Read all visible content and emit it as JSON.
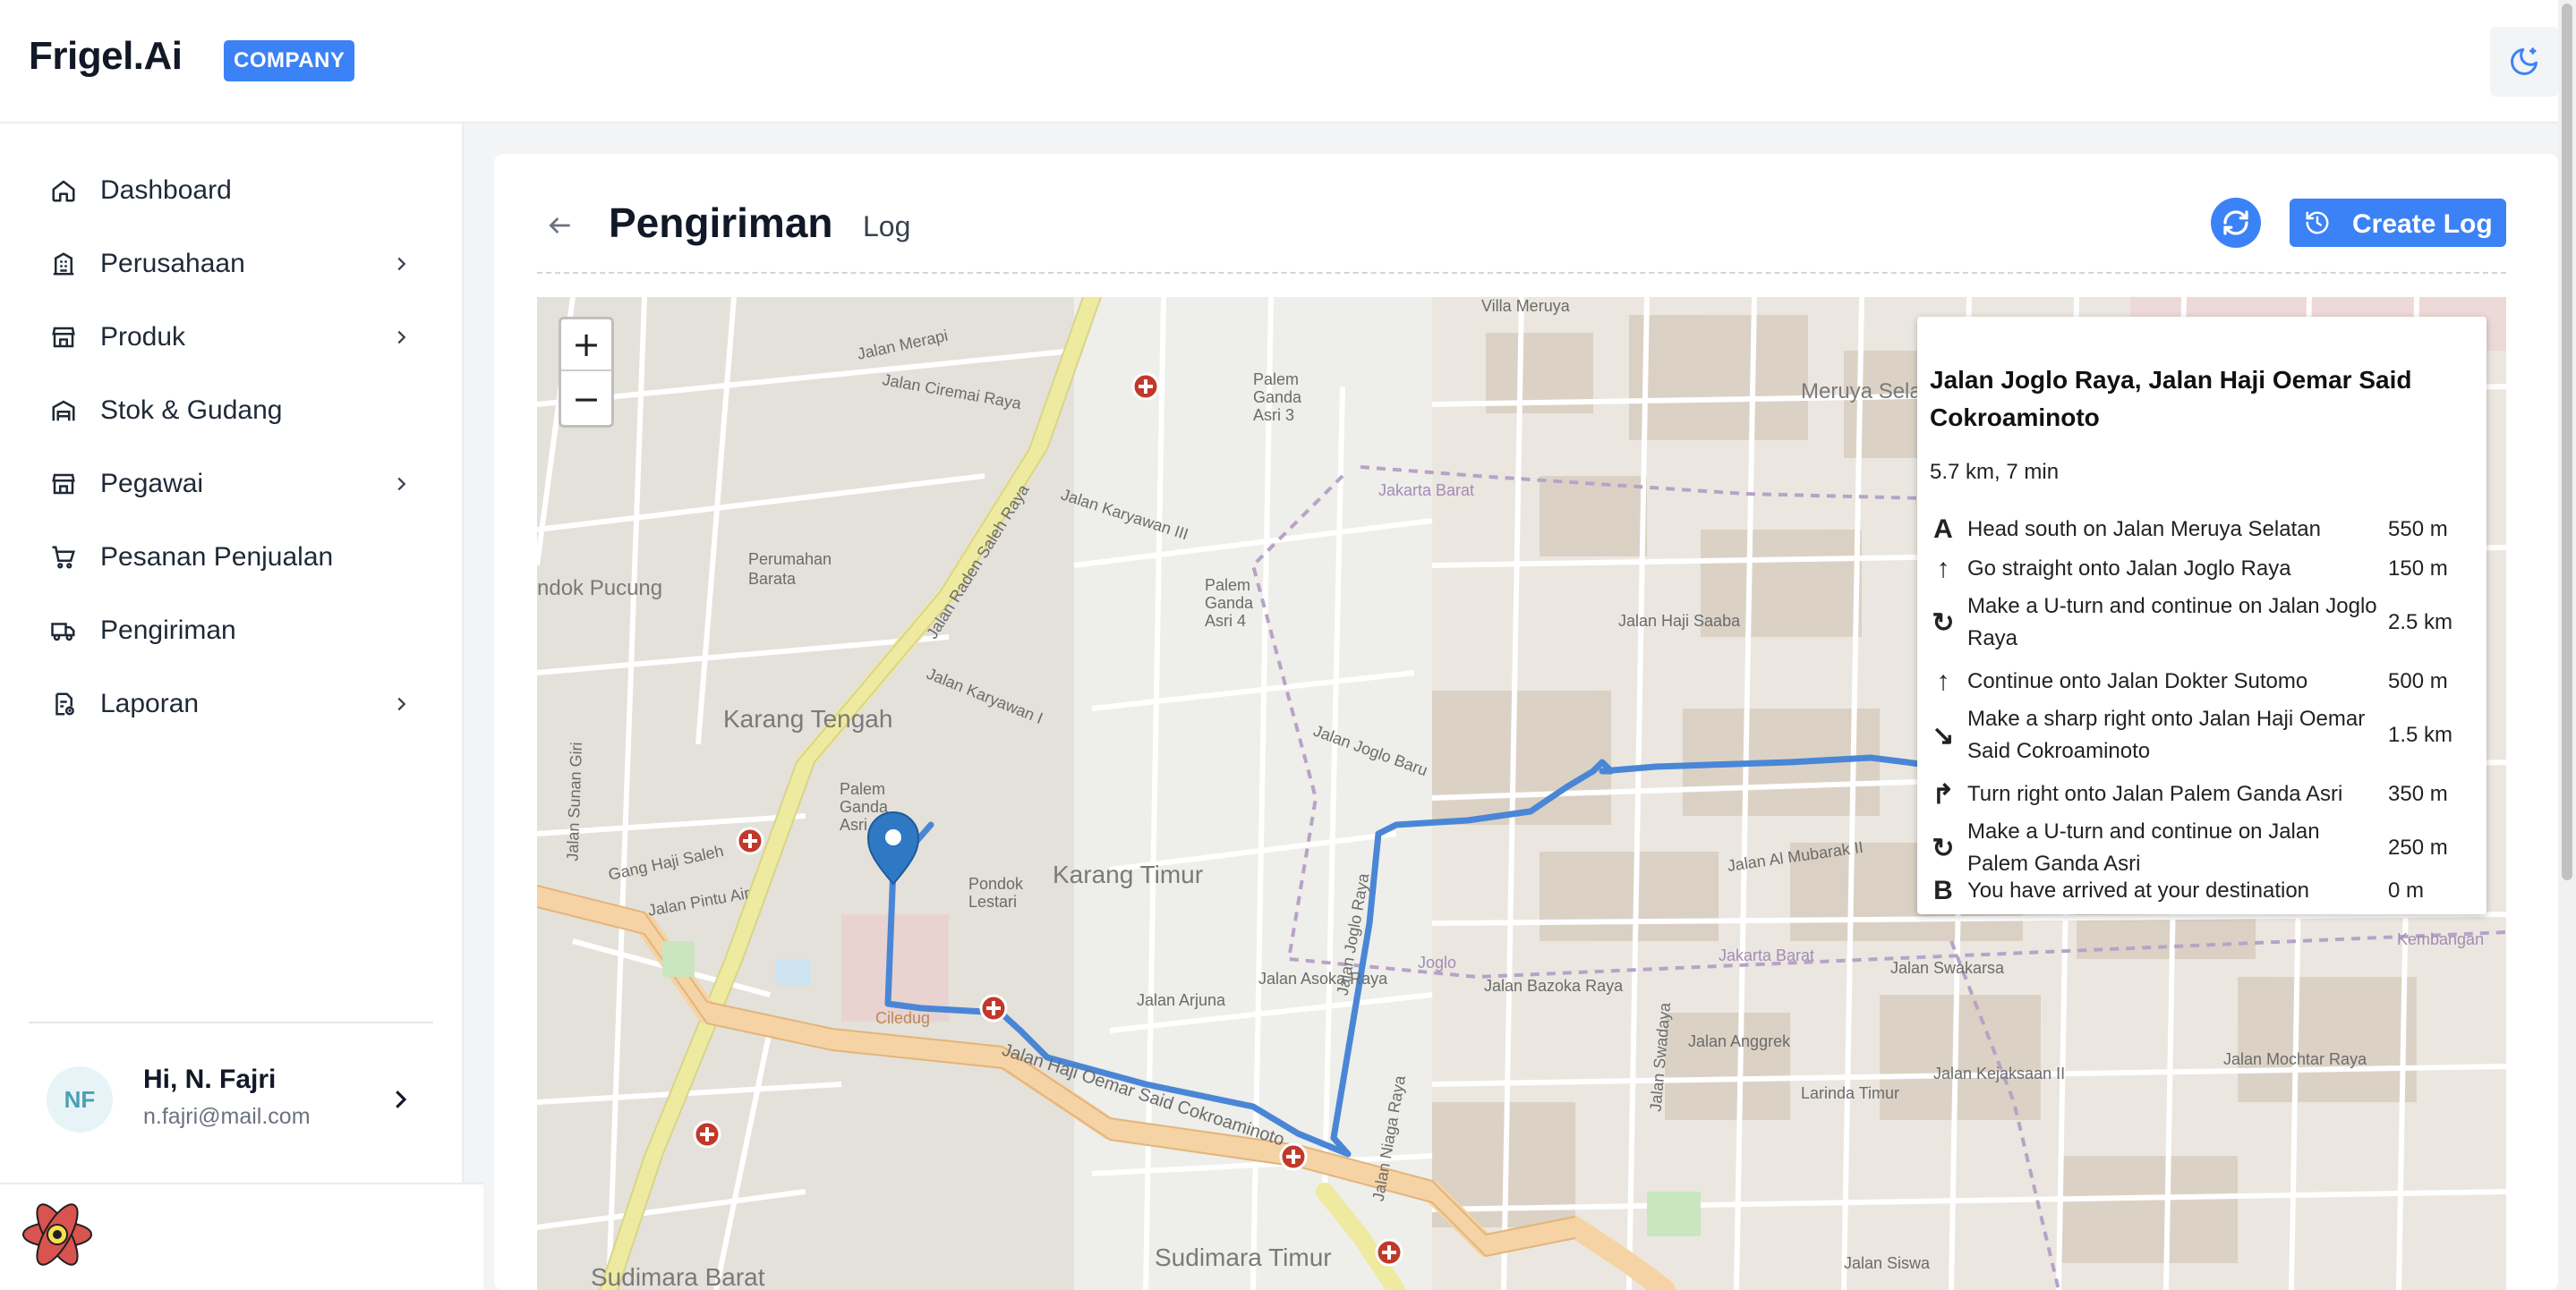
{
  "header": {
    "brand": "Frigel.Ai",
    "badge": "COMPANY",
    "theme_icon": "moon-icon"
  },
  "sidebar": {
    "items": [
      {
        "label": "Dashboard",
        "icon": "home-icon",
        "has_submenu": false
      },
      {
        "label": "Perusahaan",
        "icon": "building-icon",
        "has_submenu": true
      },
      {
        "label": "Produk",
        "icon": "store-icon",
        "has_submenu": true
      },
      {
        "label": "Stok & Gudang",
        "icon": "warehouse-icon",
        "has_submenu": false
      },
      {
        "label": "Pegawai",
        "icon": "store-icon",
        "has_submenu": true
      },
      {
        "label": "Pesanan Penjualan",
        "icon": "cart-icon",
        "has_submenu": false
      },
      {
        "label": "Pengiriman",
        "icon": "truck-icon",
        "has_submenu": false
      },
      {
        "label": "Laporan",
        "icon": "report-icon",
        "has_submenu": true
      }
    ],
    "user": {
      "initials": "NF",
      "greeting": "Hi, N. Fajri",
      "email": "n.fajri@mail.com"
    }
  },
  "page": {
    "title": "Pengiriman",
    "subtitle": "Log",
    "create_button": "Create Log",
    "accent": "#3b82f6"
  },
  "map": {
    "zoom_in": "+",
    "zoom_out": "−",
    "route_color": "#4a86d6",
    "labels": {
      "villa_meruya": "Villa Meruya",
      "meruya_selatan": "Meruya Selatan",
      "jakarta_barat_1": "Jakarta Barat",
      "jakarta_barat_2": "Jakarta Barat",
      "pondok_pucung": "ndok Pucung",
      "karang_tengah": "Karang Tengah",
      "karang_timur": "Karang Timur",
      "sudimara_barat": "Sudimara Barat",
      "sudimara_timur": "Sudimara Timur",
      "ciledug": "Ciledug",
      "joglo": "Joglo",
      "kembangan": "Kembangan",
      "jalan_raden_saleh_raya": "Jalan Raden Saleh Raya",
      "jalan_haji_oemar": "Jalan Haji Oemar Said Cokroaminoto",
      "jalan_joglo_raya": "Jalan Joglo Raya",
      "jalan_bazoka_raya": "Jalan Bazoka Raya",
      "jalan_asoka_raya": "Jalan Asoka Raya",
      "jalan_swakarsa": "Jalan Swakarsa",
      "jalan_mochtar_raya": "Jalan Mochtar Raya",
      "jalan_karyawan_iii": "Jalan Karyawan III",
      "jalan_karyawan_i": "Jalan Karyawan I",
      "jalan_merapi": "Jalan Merapi",
      "jalan_ciremai_raya": "Jalan Ciremai Raya",
      "perumahan_barata": "Perumahan Barata",
      "palem_ganda_asri_3": "Palem Ganda Asri 3",
      "palem_ganda_asri_4": "Palem Ganda Asri 4",
      "palem_ganda_asri": "Palem Ganda Asri",
      "pondok_lestari": "Pondok Lestari",
      "gang_haji_saleh": "Gang Haji Saleh",
      "jalan_pintu_air": "Jalan Pintu Air",
      "jalan_sunan_giri": "Jalan Sunan Giri",
      "jalan_arjuna": "Jalan Arjuna",
      "jalan_haji_saaba": "Jalan Haji Saaba",
      "jalan_al_mubarak": "Jalan Al Mubarak II",
      "jalan_angrek": "Jalan Anggrek",
      "jalan_kejaksaan": "Jalan Kejaksaan II",
      "jalan_joglo_baru": "Jalan Joglo Baru",
      "jalan_niaga_raya": "Jalan Niaga Raya",
      "jalan_siswa": "Jalan Siswa",
      "larinda_timur": "Larinda Timur",
      "jalan_swadaya": "Jalan Swadaya"
    }
  },
  "route": {
    "title": "Jalan Joglo Raya, Jalan Haji Oemar Said Cokroaminoto",
    "summary": "5.7 km, 7 min",
    "steps": [
      {
        "icon": "A",
        "icon_name": "start-marker-icon",
        "text": "Head south on Jalan Meruya Selatan",
        "distance": "550 m"
      },
      {
        "icon": "↑",
        "icon_name": "straight-arrow-icon",
        "text": "Go straight onto Jalan Joglo Raya",
        "distance": "150 m"
      },
      {
        "icon": "↻",
        "icon_name": "u-turn-icon",
        "text": "Make a U-turn and continue on Jalan Joglo Raya",
        "distance": "2.5 km"
      },
      {
        "icon": "↑",
        "icon_name": "straight-arrow-icon",
        "text": "Continue onto Jalan Dokter Sutomo",
        "distance": "500 m"
      },
      {
        "icon": "↘",
        "icon_name": "sharp-right-icon",
        "text": "Make a sharp right onto Jalan Haji Oemar Said Cokroaminoto",
        "distance": "1.5 km"
      },
      {
        "icon": "↱",
        "icon_name": "turn-right-icon",
        "text": "Turn right onto Jalan Palem Ganda Asri",
        "distance": "350 m"
      },
      {
        "icon": "↻",
        "icon_name": "u-turn-icon",
        "text": "Make a U-turn and continue on Jalan Palem Ganda Asri",
        "distance": "250 m"
      },
      {
        "icon": "B",
        "icon_name": "end-marker-icon",
        "text": "You have arrived at your destination",
        "distance": "0 m"
      }
    ]
  }
}
